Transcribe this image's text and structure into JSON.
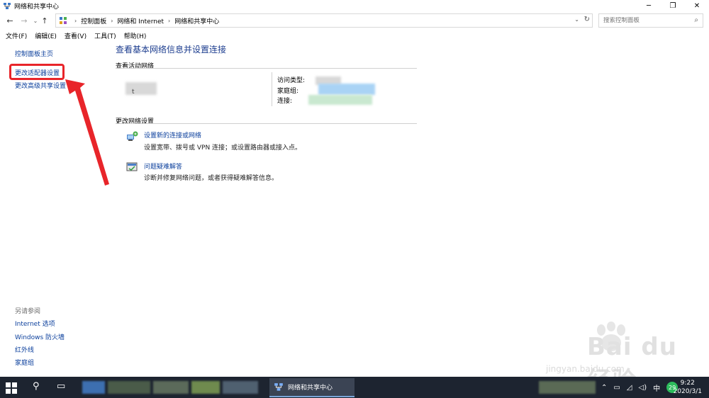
{
  "window": {
    "title": "网络和共享中心",
    "minimize": "─",
    "restore": "❐",
    "close": "✕"
  },
  "address": {
    "back": "←",
    "forward": "→",
    "recent": "⌄",
    "up": "↑",
    "breadcrumb": [
      "控制面板",
      "网络和 Internet",
      "网络和共享中心"
    ],
    "dropdown": "⌄",
    "refresh": "↻",
    "search_placeholder": "搜索控制面板",
    "search_icon": "⌕"
  },
  "menu": [
    "文件(F)",
    "编辑(E)",
    "查看(V)",
    "工具(T)",
    "帮助(H)"
  ],
  "sidebar": {
    "links": [
      "控制面板主页",
      "更改适配器设置",
      "更改高级共享设置"
    ],
    "see_also_heading": "另请参阅",
    "see_also": [
      "Internet 选项",
      "Windows 防火墙",
      "红外线",
      "家庭组"
    ]
  },
  "main": {
    "title": "查看基本网络信息并设置连接",
    "active_networks_heading": "查看活动网络",
    "network_name": "　t",
    "access_type_label": "访问类型:",
    "homegroup_label": "家庭组:",
    "connection_label": "连接:",
    "change_settings_heading": "更改网络设置",
    "items": [
      {
        "link": "设置新的连接或网络",
        "desc": "设置宽带、拨号或 VPN 连接；或设置路由器或接入点。"
      },
      {
        "link": "问题疑难解答",
        "desc": "诊断并修复网络问题，或者获得疑难解答信息。"
      }
    ]
  },
  "watermark": {
    "brand": "Bai du 经验",
    "url": "jingyan.baidu.com"
  },
  "taskbar": {
    "search_icon": "⚲",
    "taskview_icon": "▭",
    "active_window": "网络和共享中心",
    "tray": [
      "⌃",
      "▭",
      "◿",
      "◁)",
      "中"
    ],
    "badge": "29",
    "time": "9:22",
    "date": "2020/3/1"
  },
  "colors": {
    "link": "#0b3f9c",
    "title": "#1c3d8f",
    "highlight": "#e8252a",
    "taskbar": "#1d2430"
  }
}
